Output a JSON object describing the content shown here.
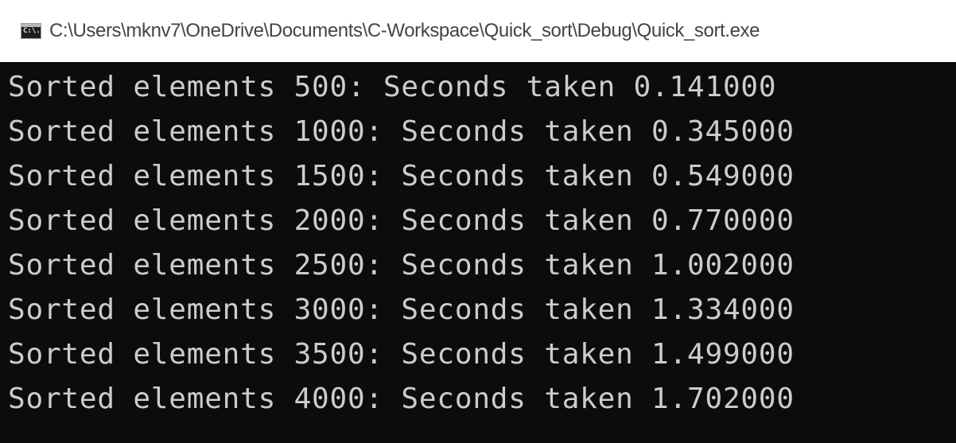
{
  "window": {
    "title": "C:\\Users\\mknv7\\OneDrive\\Documents\\C-Workspace\\Quick_sort\\Debug\\Quick_sort.exe",
    "icon": "console-app-icon",
    "icon_text": "C:\\."
  },
  "console": {
    "lines": [
      "Sorted elements 500: Seconds taken 0.141000",
      "Sorted elements 1000: Seconds taken 0.345000",
      "Sorted elements 1500: Seconds taken 0.549000",
      "Sorted elements 2000: Seconds taken 0.770000",
      "Sorted elements 2500: Seconds taken 1.002000",
      "Sorted elements 3000: Seconds taken 1.334000",
      "Sorted elements 3500: Seconds taken 1.499000",
      "Sorted elements 4000: Seconds taken 1.702000"
    ]
  },
  "colors": {
    "console_background": "#0c0c0c",
    "console_text": "#cccccc",
    "titlebar_background": "#ffffff",
    "titlebar_text": "#444444"
  }
}
